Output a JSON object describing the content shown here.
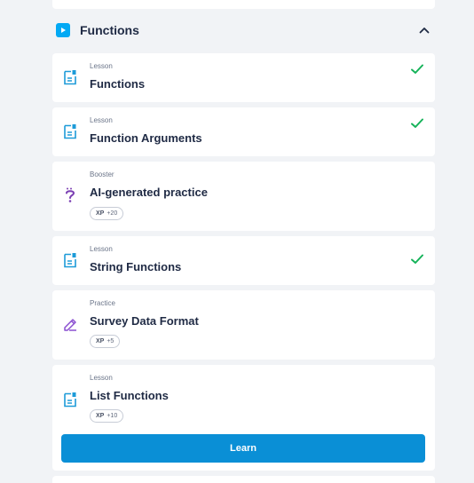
{
  "section": {
    "title": "Functions",
    "accent_color": "#03a9f4"
  },
  "items": [
    {
      "type": "Lesson",
      "title": "Functions",
      "icon": "lesson-document-icon",
      "completed": true
    },
    {
      "type": "Lesson",
      "title": "Function Arguments",
      "icon": "lesson-document-icon",
      "completed": true
    },
    {
      "type": "Booster",
      "title": "AI-generated practice",
      "icon": "question-mark-icon",
      "completed": false,
      "xp_label": "XP",
      "xp_value": "+20"
    },
    {
      "type": "Lesson",
      "title": "String Functions",
      "icon": "lesson-document-icon",
      "completed": true
    },
    {
      "type": "Practice",
      "title": "Survey Data Format",
      "icon": "pencil-practice-icon",
      "completed": false,
      "xp_label": "XP",
      "xp_value": "+5"
    },
    {
      "type": "Lesson",
      "title": "List Functions",
      "icon": "lesson-document-icon",
      "completed": false,
      "xp_label": "XP",
      "xp_value": "+10"
    }
  ],
  "learn_button_label": "Learn",
  "colors": {
    "check_green": "#16b35a",
    "lesson_blue": "#1d9bd8",
    "booster_purple": "#7b3fb3",
    "button_blue": "#0a8fd6"
  }
}
